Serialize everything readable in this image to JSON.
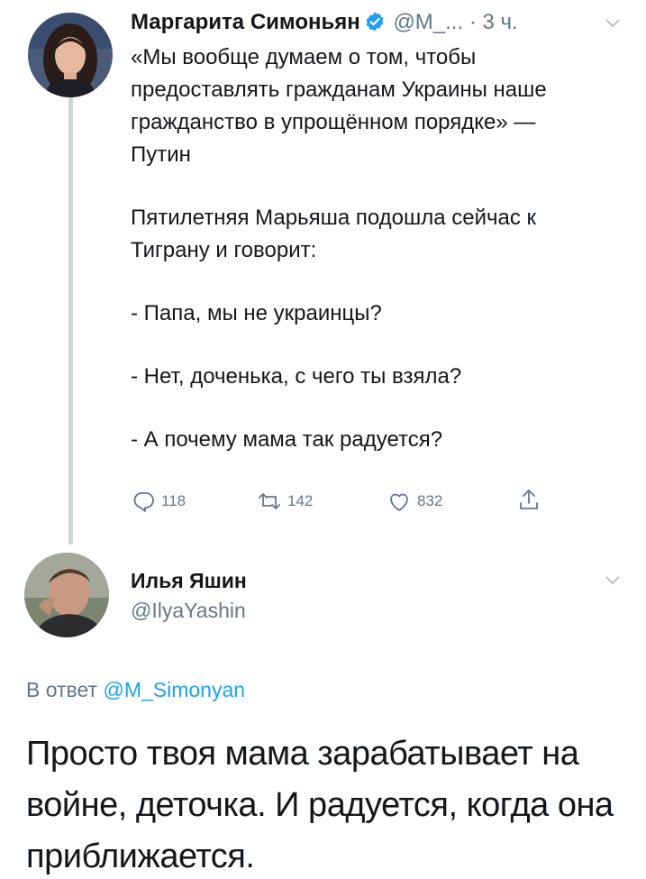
{
  "tweet1": {
    "author_name": "Маргарита Симоньян",
    "handle": "@M_...",
    "separator": "·",
    "time": "3 ч.",
    "paragraphs": [
      "«Мы вообще думаем о том, чтобы предоставлять гражданам Украины наше гражданство в упрощённом порядке» — Путин",
      "Пятилетняя Марьяша подошла сейчас к Тиграну и говорит:",
      "- Папа, мы не украинцы?",
      "- Нет, доченька, с чего ты взяла?",
      "- А почему мама так радуется?"
    ],
    "actions": {
      "reply_count": "118",
      "retweet_count": "142",
      "like_count": "832"
    }
  },
  "tweet2": {
    "author_name": "Илья Яшин",
    "handle": "@IlyaYashin",
    "reply_prefix": "В ответ",
    "reply_handle": "@M_Simonyan",
    "text": "Просто твоя мама зарабатывает на войне, деточка. И радуется, когда она приближается."
  },
  "colors": {
    "text": "#14171a",
    "secondary": "#657786",
    "link": "#1da1f2",
    "verified": "#1da1f2",
    "thread_line": "#ccd6dd"
  },
  "icons": [
    "verified-badge-icon",
    "chevron-down-icon",
    "reply-icon",
    "retweet-icon",
    "like-heart-icon",
    "share-icon"
  ]
}
